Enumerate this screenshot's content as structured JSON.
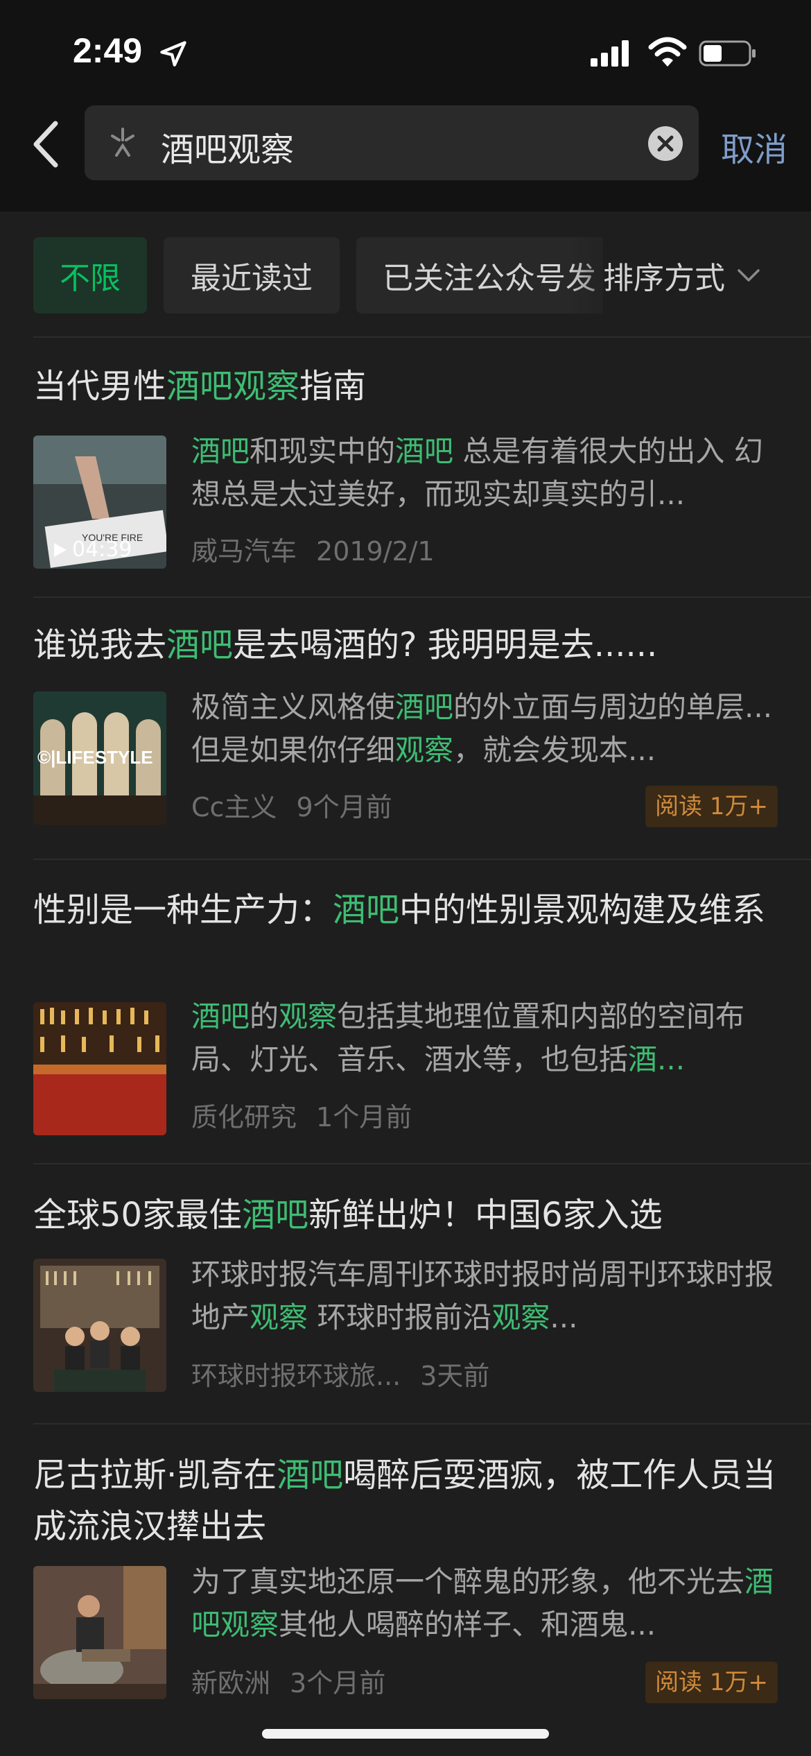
{
  "status": {
    "time": "2:49"
  },
  "search": {
    "query": "酒吧观察",
    "cancel_label": "取消"
  },
  "filters": {
    "chips": [
      "不限",
      "最近读过",
      "已关注公众号发"
    ],
    "sort_label": "排序方式"
  },
  "colors": {
    "accent": "#07c160",
    "highlight": "#3ebd73",
    "badge": "#d08a3a",
    "link": "#7f9dc9"
  },
  "results": [
    {
      "title": [
        {
          "t": "当代男性"
        },
        {
          "t": "酒吧观察",
          "h": true
        },
        {
          "t": "指南"
        }
      ],
      "snippet": [
        {
          "t": "酒吧",
          "h": true
        },
        {
          "t": "和现实中的"
        },
        {
          "t": "酒吧",
          "h": true
        },
        {
          "t": " 总是有着很大的出入 幻想总是太过美好，而现实却真实的引..."
        }
      ],
      "source": "威马汽车",
      "date": "2019/2/1",
      "duration": "04:39",
      "thumb_caption": "YOU'RE FIRE"
    },
    {
      "title": [
        {
          "t": "谁说我去"
        },
        {
          "t": "酒吧",
          "h": true
        },
        {
          "t": "是去喝酒的? 我明明是去......"
        }
      ],
      "snippet": [
        {
          "t": "极简主义风格使"
        },
        {
          "t": "酒吧",
          "h": true
        },
        {
          "t": "的外立面与周边的单层...但是如果你仔细"
        },
        {
          "t": "观察",
          "h": true
        },
        {
          "t": "，就会发现本..."
        }
      ],
      "source": "Cc主义",
      "date": "9个月前",
      "badge": "阅读 1万+",
      "thumb_caption": "©|LIFESTYLE"
    },
    {
      "title": [
        {
          "t": "性别是一种生产力："
        },
        {
          "t": "酒吧",
          "h": true
        },
        {
          "t": "中的性别景观构建及维系"
        }
      ],
      "snippet": [
        {
          "t": "酒吧",
          "h": true
        },
        {
          "t": "的"
        },
        {
          "t": "观察",
          "h": true
        },
        {
          "t": "包括其地理位置和内部的空间布局、灯光、音乐、酒水等，也包括"
        },
        {
          "t": "酒...",
          "h": true
        }
      ],
      "source": "质化研究",
      "date": "1个月前"
    },
    {
      "title": [
        {
          "t": "全球50家最佳"
        },
        {
          "t": "酒吧",
          "h": true
        },
        {
          "t": "新鲜出炉！中国6家入选"
        }
      ],
      "snippet": [
        {
          "t": "环球时报汽车周刊环球时报时尚周刊环球时报地产"
        },
        {
          "t": "观察",
          "h": true
        },
        {
          "t": " 环球时报前沿"
        },
        {
          "t": "观察",
          "h": true
        },
        {
          "t": "..."
        }
      ],
      "source": "环球时报环球旅...",
      "date": "3天前"
    },
    {
      "title": [
        {
          "t": "尼古拉斯·凯奇在"
        },
        {
          "t": "酒吧",
          "h": true
        },
        {
          "t": "喝醉后耍酒疯，被工作人员当成流浪汉撵出去"
        }
      ],
      "snippet": [
        {
          "t": "为了真实地还原一个醉鬼的形象，他不光去"
        },
        {
          "t": "酒吧观察",
          "h": true
        },
        {
          "t": "其他人喝醉的样子、和酒鬼..."
        }
      ],
      "source": "新欧洲",
      "date": "3个月前",
      "badge": "阅读 1万+"
    }
  ]
}
